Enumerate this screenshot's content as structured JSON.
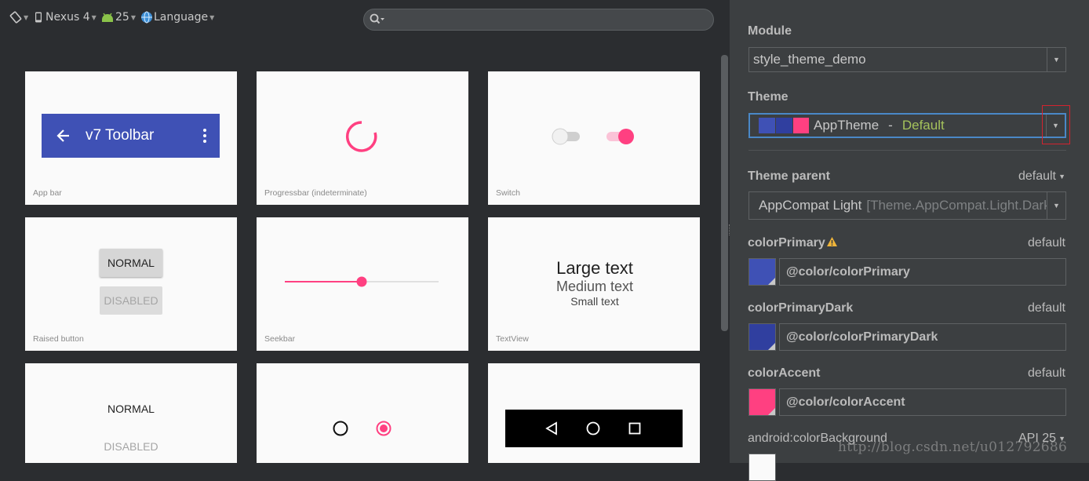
{
  "toolbar": {
    "device": "Nexus 4",
    "api": "25",
    "language": "Language",
    "search_placeholder": ""
  },
  "cards": {
    "app_bar": {
      "caption": "App bar",
      "toolbar_title": "v7 Toolbar"
    },
    "progressbar": {
      "caption": "Progressbar (indeterminate)"
    },
    "switch": {
      "caption": "Switch"
    },
    "raised_button": {
      "caption": "Raised button",
      "normal": "NORMAL",
      "disabled": "DISABLED"
    },
    "seekbar": {
      "caption": "Seekbar",
      "value_percent": 50
    },
    "textview": {
      "caption": "TextView",
      "large": "Large text",
      "medium": "Medium text",
      "small": "Small text"
    },
    "flat_button": {
      "normal": "NORMAL",
      "disabled": "DISABLED"
    }
  },
  "panel": {
    "module": {
      "label": "Module",
      "value": "style_theme_demo"
    },
    "theme": {
      "label": "Theme",
      "name": "AppTheme",
      "separator": "-",
      "tag": "Default"
    },
    "theme_parent": {
      "label": "Theme parent",
      "default": "default",
      "value": "AppCompat Light",
      "hint": "[Theme.AppCompat.Light.DarkActionBar]"
    },
    "attributes": [
      {
        "label": "colorPrimary",
        "default": "default",
        "value": "@color/colorPrimary",
        "color": "#3f51b5"
      },
      {
        "label": "colorPrimaryDark",
        "default": "default",
        "value": "@color/colorPrimaryDark",
        "color": "#303f9f"
      },
      {
        "label": "colorAccent",
        "default": "default",
        "value": "@color/colorAccent",
        "color": "#ff4081"
      },
      {
        "label": "android:colorBackground",
        "default": "API 25"
      }
    ]
  },
  "watermark": "http://blog.csdn.net/u012792686",
  "colors": {
    "primary": "#3f51b5",
    "primary_dark": "#303f9f",
    "accent": "#ff4081",
    "highlight": "#d3232f"
  }
}
